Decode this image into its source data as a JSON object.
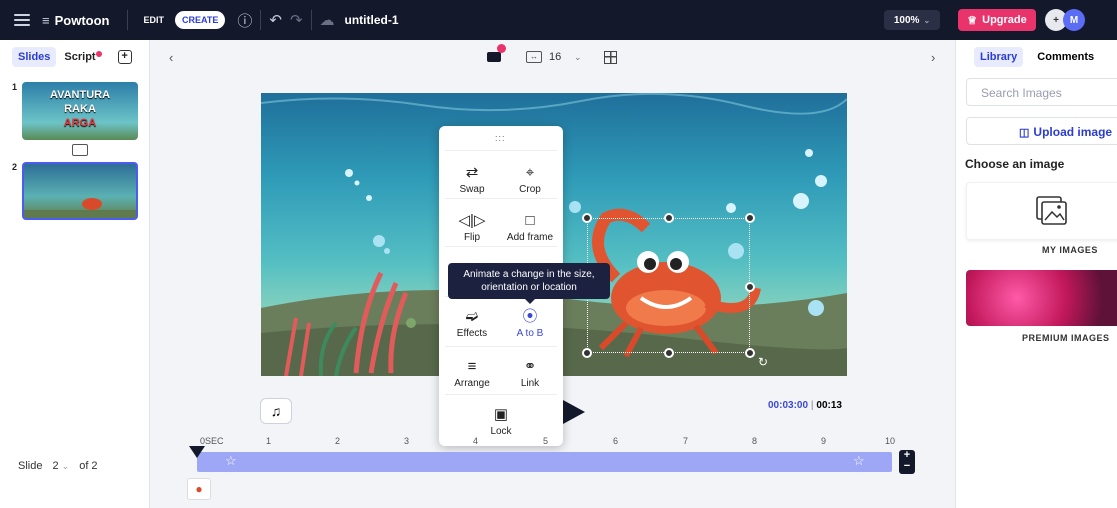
{
  "topbar": {
    "app_name": "Powtoon",
    "mode_edit": "EDIT",
    "mode_create": "CREATE",
    "filename": "untitled-1",
    "zoom": "100%",
    "upgrade_label": "Upgrade",
    "avatar_initial": "M"
  },
  "left_panel": {
    "tab_slides": "Slides",
    "tab_script": "Script",
    "slides": [
      {
        "number": "1",
        "title_lines": [
          "AVANTURA",
          "RAKA",
          "ARGA"
        ]
      },
      {
        "number": "2"
      }
    ],
    "footer_slide": "Slide",
    "footer_current": "2",
    "footer_of": "of 2"
  },
  "canvas_toolbar": {
    "grid_size": "16"
  },
  "context_menu": {
    "items": [
      {
        "label": "Swap",
        "icon": "swap-icon"
      },
      {
        "label": "Crop",
        "icon": "crop-icon"
      },
      {
        "label": "Flip",
        "icon": "flip-icon"
      },
      {
        "label": "Add frame",
        "icon": "frame-icon"
      },
      {
        "label": "Effects",
        "icon": "effects-icon"
      },
      {
        "label": "A to B",
        "icon": "a-to-b-icon"
      },
      {
        "label": "Arrange",
        "icon": "layers-icon"
      },
      {
        "label": "Link",
        "icon": "link-icon"
      },
      {
        "label": "Lock",
        "icon": "lock-icon"
      }
    ],
    "tooltip": "Animate a change in the size, orientation or location"
  },
  "timeline": {
    "current_time": "00:03:00",
    "total_time": "00:13",
    "ruler_labels": [
      "0SEC",
      "1",
      "2",
      "3",
      "4",
      "5",
      "6",
      "7",
      "8",
      "9",
      "10"
    ]
  },
  "right_panel": {
    "tab_library": "Library",
    "tab_comments": "Comments",
    "search_placeholder": "Search Images",
    "upload_label": "Upload image",
    "choose_heading": "Choose an image",
    "my_images": "MY IMAGES",
    "premium_images": "PREMIUM IMAGES"
  },
  "colors": {
    "topbar_bg": "#14182b",
    "accent": "#2b3dd1",
    "upgrade": "#e9336b",
    "timeline_track": "#9da7f5"
  }
}
